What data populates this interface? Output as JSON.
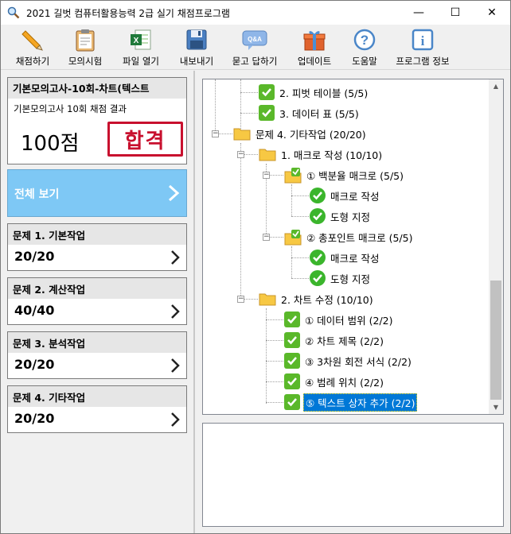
{
  "window": {
    "title": "2021 길벗 컴퓨터활용능력 2급 실기 채점프로그램",
    "controls": {
      "minimize": "—",
      "maximize": "☐",
      "close": "✕"
    }
  },
  "toolbar": {
    "items": [
      {
        "label": "채점하기",
        "icon": "pencil-icon"
      },
      {
        "label": "모의시험",
        "icon": "clipboard-icon"
      },
      {
        "label": "파일 열기",
        "icon": "excel-file-icon"
      },
      {
        "label": "내보내기",
        "icon": "floppy-disk-icon"
      },
      {
        "label": "묻고 답하기",
        "icon": "qa-bubble-icon",
        "badge": "Q&A"
      },
      {
        "label": "업데이트",
        "icon": "gift-box-icon"
      },
      {
        "label": "도움말",
        "icon": "question-icon",
        "glyph": "?"
      },
      {
        "label": "프로그램 정보",
        "icon": "info-icon",
        "glyph": "i"
      }
    ]
  },
  "result": {
    "title": "기본모의고사-10회-차트(텍스트",
    "subtitle": "기본모의고사 10회 채점 결과",
    "score": "100점",
    "stamp": "합격",
    "stamp_color": "#c8102e"
  },
  "all_view": {
    "label": "전체 보기"
  },
  "questions": [
    {
      "title": "문제 1. 기본작업",
      "score": "20/20"
    },
    {
      "title": "문제 2. 계산작업",
      "score": "40/40"
    },
    {
      "title": "문제 3. 분석작업",
      "score": "20/20"
    },
    {
      "title": "문제 4. 기타작업",
      "score": "20/20"
    }
  ],
  "tree": {
    "nodes": [
      {
        "label": "2. 피벗 테이블 (5/5)",
        "icon": "check-square"
      },
      {
        "label": "3. 데이터 표 (5/5)",
        "icon": "check-square"
      },
      {
        "label": "문제 4. 기타작업 (20/20)",
        "icon": "folder",
        "expander": "−"
      },
      {
        "label": "1. 매크로 작성 (10/10)",
        "icon": "folder",
        "expander": "−"
      },
      {
        "label": "① 백분율 매크로 (5/5)",
        "icon": "folder-check",
        "expander": "−"
      },
      {
        "label": "매크로 작성",
        "icon": "check-circle"
      },
      {
        "label": "도형 지정",
        "icon": "check-circle"
      },
      {
        "label": "② 총포인트 매크로 (5/5)",
        "icon": "folder-check",
        "expander": "−"
      },
      {
        "label": "매크로 작성",
        "icon": "check-circle"
      },
      {
        "label": "도형 지정",
        "icon": "check-circle"
      },
      {
        "label": "2. 차트 수정 (10/10)",
        "icon": "folder",
        "expander": "−"
      },
      {
        "label": "① 데이터 범위 (2/2)",
        "icon": "check-square"
      },
      {
        "label": "② 차트 제목 (2/2)",
        "icon": "check-square"
      },
      {
        "label": "③ 3차원 회전 서식 (2/2)",
        "icon": "check-square"
      },
      {
        "label": "④ 범례 위치 (2/2)",
        "icon": "check-square"
      },
      {
        "label": "⑤ 텍스트 상자 추가 (2/2)",
        "icon": "check-square",
        "selected": true
      }
    ]
  },
  "colors": {
    "accent_blue": "#7ec8f5",
    "check_green": "#5ab82a",
    "selection": "#0078d7",
    "folder_yellow": "#f7c843"
  }
}
